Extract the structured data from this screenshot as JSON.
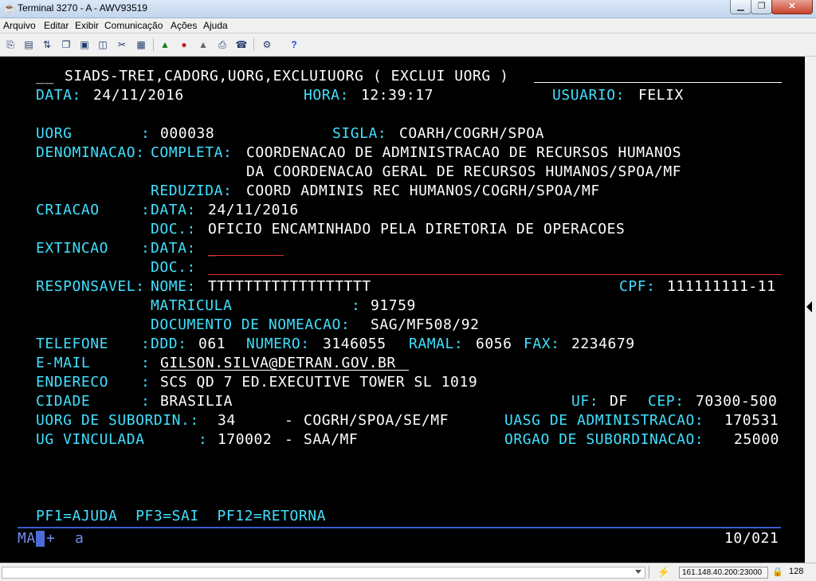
{
  "window": {
    "title": "Terminal 3270 - A - AWV93519"
  },
  "menu": [
    "Arquivo",
    "Editar",
    "Exibir",
    "Comunicação",
    "Ações",
    "Ajuda"
  ],
  "toolbar_icons": [
    "copy-screen-icon",
    "paste-icon",
    "transfer-icon",
    "copy-icon",
    "paste-append-icon",
    "macro-icon",
    "keypad-icon",
    "record-start-icon",
    "record-stop-icon",
    "play-icon",
    "print-icon",
    "session-icon",
    "help-icon"
  ],
  "screen": {
    "command_prompt": "__",
    "command_text": "SIADS-TREI,CADORG,UORG,EXCLUIUORG ( EXCLUI UORG )",
    "data_label": "DATA:",
    "data_value": "24/11/2016",
    "hora_label": "HORA:",
    "hora_value": "12:39:17",
    "usuario_label": "USUARIO:",
    "usuario_value": "FELIX",
    "uorg_label": "UORG",
    "uorg_colon": ":",
    "uorg_value": "000038",
    "sigla_label": "SIGLA:",
    "sigla_value": "COARH/COGRH/SPOA",
    "denominacao_label": "DENOMINACAO:",
    "completa_label": "COMPLETA:",
    "completa_line1": "COORDENACAO DE ADMINISTRACAO DE RECURSOS HUMANOS",
    "completa_line2": "DA COORDENACAO GERAL DE RECURSOS HUMANOS/SPOA/MF",
    "reduzida_label": "REDUZIDA:",
    "reduzida_value": "COORD ADMINIS REC HUMANOS/COGRH/SPOA/MF",
    "criacao_label": "CRIACAO",
    "criacao_colon": ":",
    "criacao_data_label": "DATA:",
    "criacao_data_value": "24/11/2016",
    "criacao_doc_label": "DOC.:",
    "criacao_doc_value": "OFICIO ENCAMINHADO PELA DIRETORIA DE OPERACOES",
    "extincao_label": "EXTINCAO",
    "extincao_colon": ":",
    "extincao_data_label": "DATA:",
    "extincao_data_value": "_",
    "extincao_doc_label": "DOC.:",
    "responsavel_label": "RESPONSAVEL:",
    "nome_label": "NOME:",
    "nome_value": "TTTTTTTTTTTTTTTTTT",
    "cpf_label": "CPF:",
    "cpf_value": "111111111-11",
    "matricula_label": "MATRICULA",
    "matricula_colon": ":",
    "matricula_value": "91759",
    "nomeacao_label": "DOCUMENTO DE NOMEACAO:",
    "nomeacao_value": "SAG/MF508/92",
    "telefone_label": "TELEFONE",
    "telefone_colon": ":",
    "ddd_label": "DDD:",
    "ddd_value": "061",
    "numero_label": "NUMERO:",
    "numero_value": "3146055",
    "ramal_label": "RAMAL:",
    "ramal_value": "6056",
    "fax_label": "FAX:",
    "fax_value": "2234679",
    "email_label": "E-MAIL",
    "email_colon": ":",
    "email_value": "GILSON.SILVA@DETRAN.GOV.BR",
    "endereco_label": "ENDERECO",
    "endereco_colon": ":",
    "endereco_value": "SCS QD 7 ED.EXECUTIVE TOWER SL 1019",
    "cidade_label": "CIDADE",
    "cidade_colon": ":",
    "cidade_value": "BRASILIA",
    "uf_label": "UF:",
    "uf_value": "DF",
    "cep_label": "CEP:",
    "cep_value": "70300-500",
    "subordin_label": "UORG DE SUBORDIN.:",
    "subordin_value": "34",
    "subordin_dash": "-",
    "subordin_sigla": "COGRH/SPOA/SE/MF",
    "uasg_label": "UASG DE ADMINISTRACAO:",
    "uasg_value": "170531",
    "ug_label": "UG VINCULADA",
    "ug_colon": ":",
    "ug_value": "170002",
    "ug_dash": "-",
    "ug_sigla": "SAA/MF",
    "orgao_label": "ORGAO DE SUBORDINACAO:",
    "orgao_value": "25000",
    "pf_keys": "PF1=AJUDA  PF3=SAI  PF12=RETORNA"
  },
  "oia": {
    "mode": "MA",
    "plus": "+",
    "indicator": "a",
    "cursor_pos": "10/021"
  },
  "statusbar": {
    "host": "161.148.40.200:23000",
    "count": "128"
  }
}
